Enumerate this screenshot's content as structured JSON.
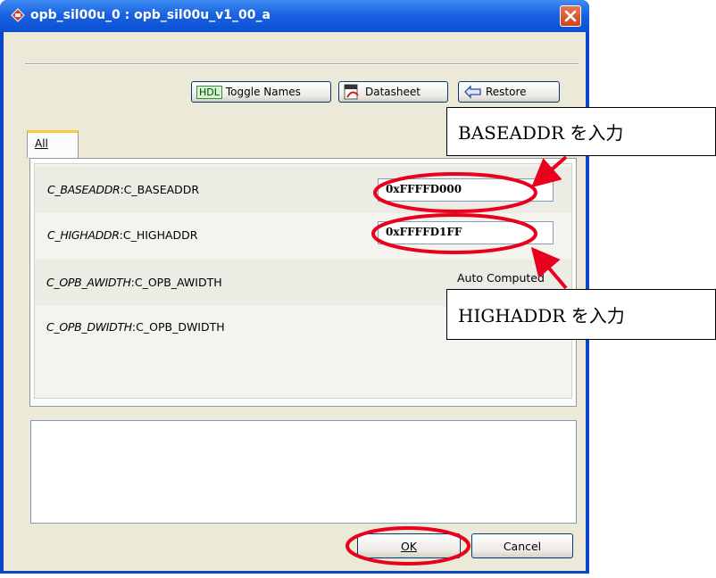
{
  "window": {
    "title": "opb_sil00u_0 : opb_sil00u_v1_00_a"
  },
  "toolbar": {
    "toggle_badge": "HDL",
    "toggle_label": "Toggle Names",
    "datasheet_label": "Datasheet",
    "restore_label": "Restore"
  },
  "tabs": [
    {
      "label": "All",
      "active": true
    }
  ],
  "parameters": [
    {
      "name_italic": "C_BASEADDR",
      "name": "C_BASEADDR",
      "value": "0xFFFFD000"
    },
    {
      "name_italic": "C_HIGHADDR",
      "name": "C_HIGHADDR",
      "value": "0xFFFFD1FF"
    },
    {
      "name_italic": "C_OPB_AWIDTH",
      "name": "C_OPB_AWIDTH",
      "value": "Auto Computed"
    },
    {
      "name_italic": "C_OPB_DWIDTH",
      "name": "C_OPB_DWIDTH",
      "value": ""
    }
  ],
  "buttons": {
    "ok_label": "OK",
    "cancel_label": "Cancel"
  },
  "annotations": {
    "baseaddr_callout": "BASEADDR を入力",
    "highaddr_callout": "HIGHADDR を入力",
    "highlight_color": "#e8001c"
  },
  "colors": {
    "titlebar": "#0b4fd2",
    "client": "#ece9d8",
    "tab_accent": "#ffc83c"
  }
}
